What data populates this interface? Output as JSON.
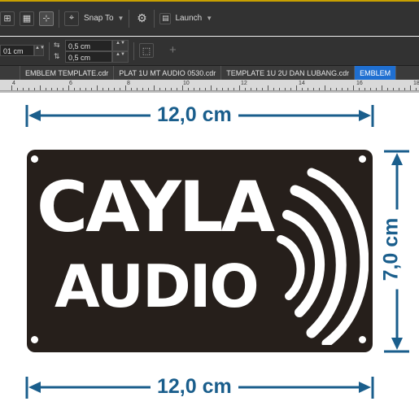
{
  "toolbar": {
    "snap_to_label": "Snap To",
    "launch_label": "Launch",
    "icons": [
      "grid-icon",
      "guidelines-icon",
      "snap-to-icon",
      "gear-icon",
      "launch-icon"
    ]
  },
  "property_bar": {
    "partial_field_value": "01 cm",
    "nudge_x_value": "0,5 cm",
    "nudge_y_value": "0,5 cm",
    "add_symbol": "+"
  },
  "document_tabs": [
    {
      "label": "EMBLEM TEMPLATE.cdr",
      "active": false
    },
    {
      "label": "PLAT 1U MT AUDIO 0530.cdr",
      "active": false
    },
    {
      "label": "TEMPLATE 1U 2U DAN LUBANG.cdr",
      "active": false
    },
    {
      "label": "EMBLEM",
      "active": true
    }
  ],
  "ruler": {
    "labels": [
      "4",
      "6",
      "8",
      "10",
      "12",
      "14",
      "16",
      "18"
    ]
  },
  "artwork": {
    "top_dimension": "12,0 cm",
    "bottom_dimension": "12,0 cm",
    "side_dimension": "7,0 cm",
    "brand_line1": "CAYLA",
    "brand_line2": "AUDIO",
    "colors": {
      "plate": "#261f1b",
      "dimension": "#1a5e8c",
      "tab_active": "#1f6fd1",
      "toolbar": "#323232"
    }
  }
}
